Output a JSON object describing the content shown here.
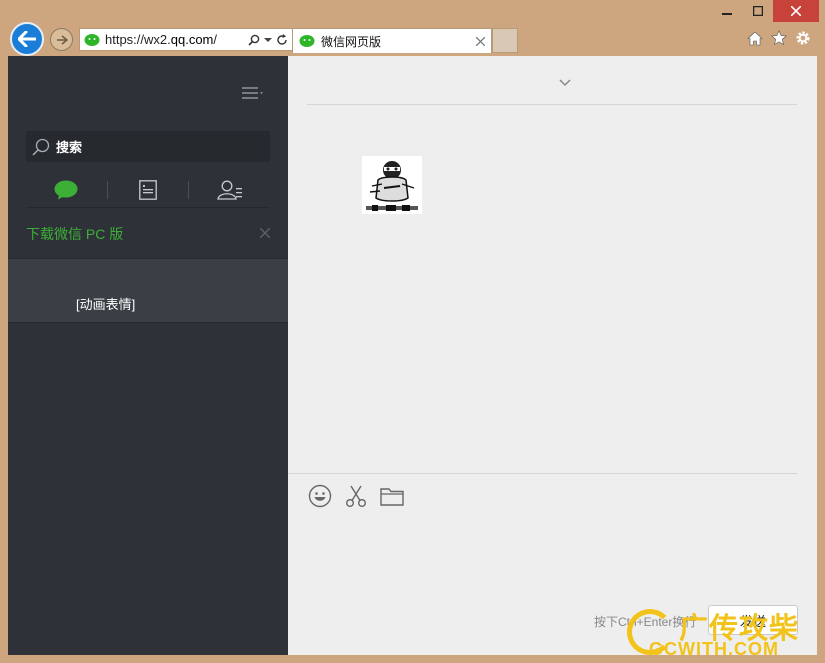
{
  "browser": {
    "url_prefix": "https://wx2.",
    "url_host": "qq.com",
    "url_suffix": "/",
    "tab_title": "微信网页版",
    "window_controls": [
      "minimize",
      "maximize",
      "close"
    ]
  },
  "sidebar": {
    "search_placeholder": "搜索",
    "download_text": "下载微信 PC 版",
    "chat_preview": "[动画表情]"
  },
  "main": {
    "hint": "按下Ctrl+Enter换行",
    "send_label": "发送"
  },
  "watermark": {
    "text": "广传攻柴",
    "sub": "GCWITH.COM"
  },
  "colors": {
    "accent_green": "#3caf36",
    "sidebar_bg": "#2e3238",
    "ie_blue": "#1a7dd7"
  }
}
